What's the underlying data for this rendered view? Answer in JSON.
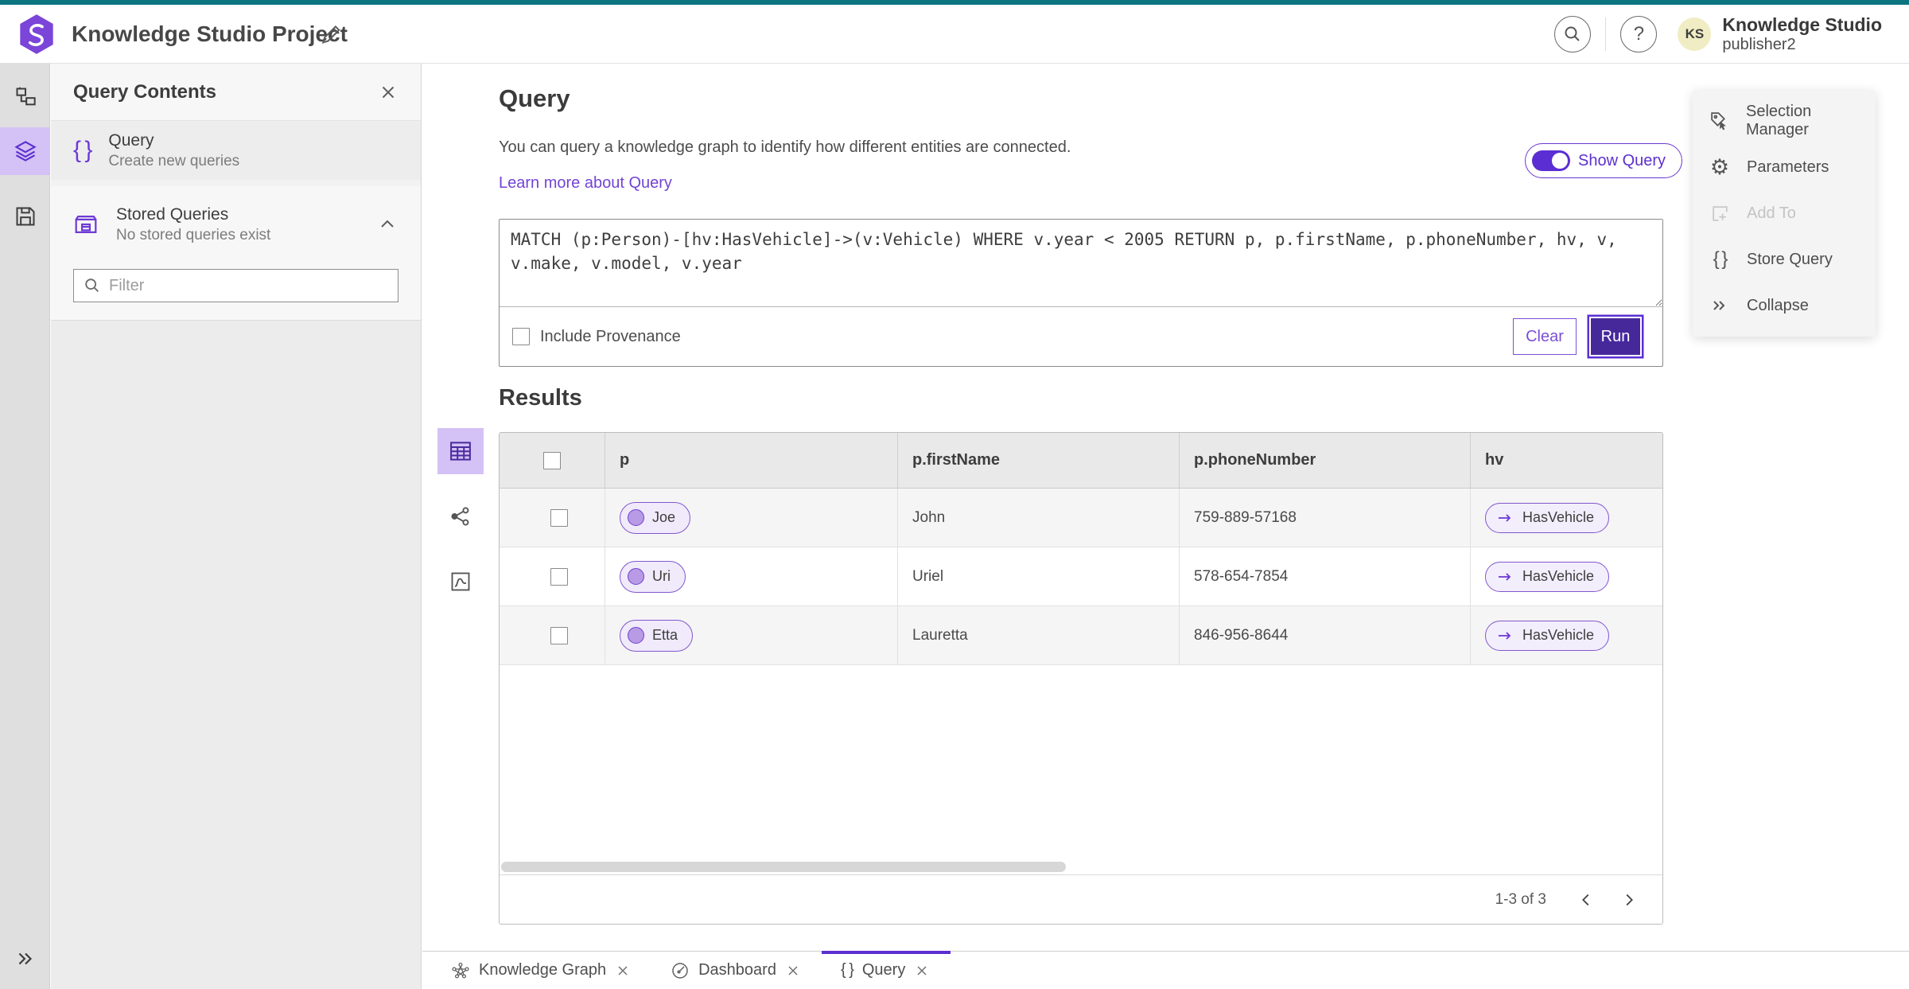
{
  "header": {
    "app_title": "Knowledge Studio Project",
    "product_name": "Knowledge Studio",
    "user_name": "publisher2",
    "avatar_initials": "KS"
  },
  "icons": {
    "help_glyph": "?",
    "braces_glyph": "{ }",
    "gear_glyph": "⚙"
  },
  "contents_panel": {
    "title": "Query Contents",
    "query_item": {
      "label": "Query",
      "description": "Create new queries"
    },
    "stored_queries": {
      "label": "Stored Queries",
      "description": "No stored queries exist"
    },
    "filter_placeholder": "Filter"
  },
  "query_section": {
    "heading": "Query",
    "description": "You can query a knowledge graph to identify how different entities are connected.",
    "learn_more_label": "Learn more about Query",
    "show_query_label": "Show Query",
    "query_text": "MATCH (p:Person)-[hv:HasVehicle]->(v:Vehicle) WHERE v.year < 2005 RETURN p, p.firstName, p.phoneNumber, hv, v, v.make, v.model, v.year",
    "include_provenance_label": "Include Provenance",
    "clear_label": "Clear",
    "run_label": "Run"
  },
  "actions_panel": {
    "items": [
      {
        "label": "Selection Manager",
        "icon": "tag-cursor-icon",
        "disabled": false
      },
      {
        "label": "Parameters",
        "icon": "gear-icon",
        "disabled": false
      },
      {
        "label": "Add To",
        "icon": "square-plus-icon",
        "disabled": true
      },
      {
        "label": "Store Query",
        "icon": "braces-icon",
        "disabled": false
      },
      {
        "label": "Collapse",
        "icon": "double-chevron-icon",
        "disabled": false
      }
    ]
  },
  "results": {
    "heading": "Results",
    "columns": [
      "p",
      "p.firstName",
      "p.phoneNumber",
      "hv"
    ],
    "rows": [
      {
        "p": "Joe",
        "firstName": "John",
        "phone": "759-889-57168",
        "hv": "HasVehicle"
      },
      {
        "p": "Uri",
        "firstName": "Uriel",
        "phone": "578-654-7854",
        "hv": "HasVehicle"
      },
      {
        "p": "Etta",
        "firstName": "Lauretta",
        "phone": "846-956-8644",
        "hv": "HasVehicle"
      }
    ],
    "pagination": {
      "range_label": "1-3 of 3"
    }
  },
  "tabs": [
    {
      "label": "Knowledge Graph"
    },
    {
      "label": "Dashboard"
    },
    {
      "label": "Query"
    }
  ],
  "colors": {
    "accent_purple": "#6e3ad6",
    "run_fill": "#46289b",
    "teal_strip": "#0d7580",
    "avatar_bg": "#f0edc4",
    "active_highlight": "#d4c1f5"
  }
}
